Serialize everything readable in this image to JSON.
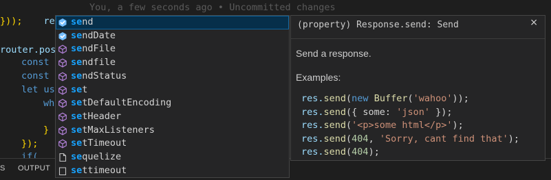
{
  "editor": {
    "cursor_line": "res.se",
    "blame": "You, a few seconds ago • Uncommitted changes",
    "lines": [
      "}));",
      "router.pos",
      "const",
      "const",
      "let us",
      "wh",
      "}",
      "});",
      "if("
    ]
  },
  "panel": {
    "tab_partial": "S",
    "tab_output": "OUTPUT"
  },
  "suggest": {
    "items": [
      {
        "match": "se",
        "rest": "nd",
        "icon": "property-icon"
      },
      {
        "match": "se",
        "rest": "ndDate",
        "icon": "property-icon"
      },
      {
        "match": "se",
        "rest": "ndFile",
        "icon": "method-icon"
      },
      {
        "match": "se",
        "rest": "ndfile",
        "icon": "method-icon"
      },
      {
        "match": "se",
        "rest": "ndStatus",
        "icon": "method-icon"
      },
      {
        "match": "se",
        "rest": "t",
        "icon": "method-icon"
      },
      {
        "match": "se",
        "rest": "tDefaultEncoding",
        "icon": "method-icon"
      },
      {
        "match": "se",
        "rest": "tHeader",
        "icon": "method-icon"
      },
      {
        "match": "se",
        "rest": "tMaxListeners",
        "icon": "method-icon"
      },
      {
        "match": "se",
        "rest": "tTimeout",
        "icon": "method-icon"
      },
      {
        "match": "se",
        "rest": "quelize",
        "icon": "file-icon"
      },
      {
        "match": "se",
        "rest": "ttimeout",
        "icon": "snippet-icon"
      }
    ]
  },
  "details": {
    "title": "(property) Response.send: Send",
    "close": "×",
    "description": "Send a response.",
    "examples_label": "Examples:",
    "code": [
      {
        "a": "res.",
        "b": "send",
        "c": "(",
        "d": "new",
        "e": " Buffer",
        "f": "(",
        "g": "'wahoo'",
        "h": "));"
      },
      {
        "a": "res.",
        "b": "send",
        "c": "({ some: ",
        "g": "'json'",
        "h": " });"
      },
      {
        "a": "res.",
        "b": "send",
        "c": "(",
        "g": "'<p>some html</p>'",
        "h": ");"
      },
      {
        "a": "res.",
        "b": "send",
        "c": "(",
        "n": "404",
        "c2": ", ",
        "g": "'Sorry, cant find that'",
        "h": ");"
      },
      {
        "a": "res.",
        "b": "send",
        "c": "(",
        "n": "404",
        "h": ");"
      }
    ]
  }
}
